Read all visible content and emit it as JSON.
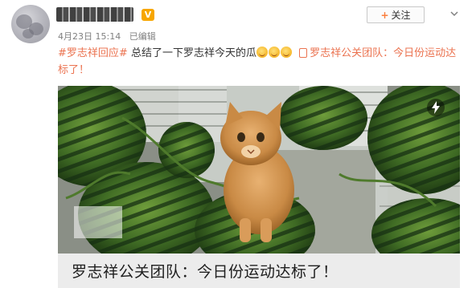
{
  "post": {
    "author_name": "",
    "vip_badge": "V",
    "date": "4月23日 15:14",
    "edited_label": "已编辑",
    "follow_label": "关注",
    "follow_plus": "+",
    "hashtag": "#罗志祥回应#",
    "text": "总结了一下罗志祥今天的瓜",
    "emoji_name": "grin-emoji",
    "linked_account": "罗志祥公关团队",
    "linked_text": "：今日份运动达标了！"
  },
  "image": {
    "caption": "罗志祥公关团队：今日份运动达标了！"
  },
  "colors": {
    "accent": "#eb7350",
    "follow_plus": "#fa7d3c",
    "meta": "#808080",
    "caption_bg": "#ececec"
  }
}
